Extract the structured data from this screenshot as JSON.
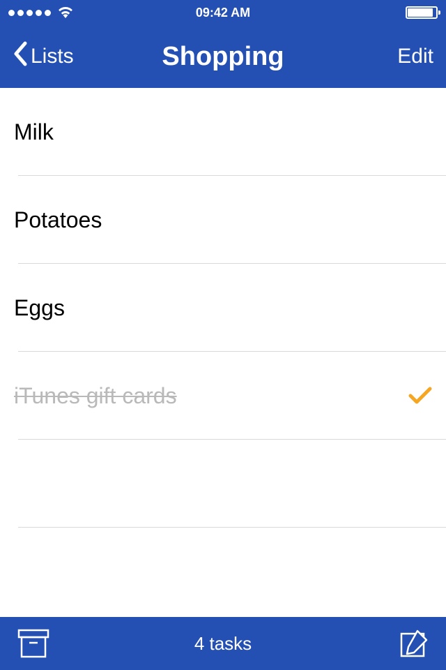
{
  "status_bar": {
    "time": "09:42 AM"
  },
  "nav": {
    "back_label": "Lists",
    "title": "Shopping",
    "edit_label": "Edit"
  },
  "tasks": [
    {
      "label": "Milk",
      "completed": false
    },
    {
      "label": "Potatoes",
      "completed": false
    },
    {
      "label": "Eggs",
      "completed": false
    },
    {
      "label": "iTunes gift cards",
      "completed": true
    }
  ],
  "toolbar": {
    "count_label": "4 tasks"
  }
}
